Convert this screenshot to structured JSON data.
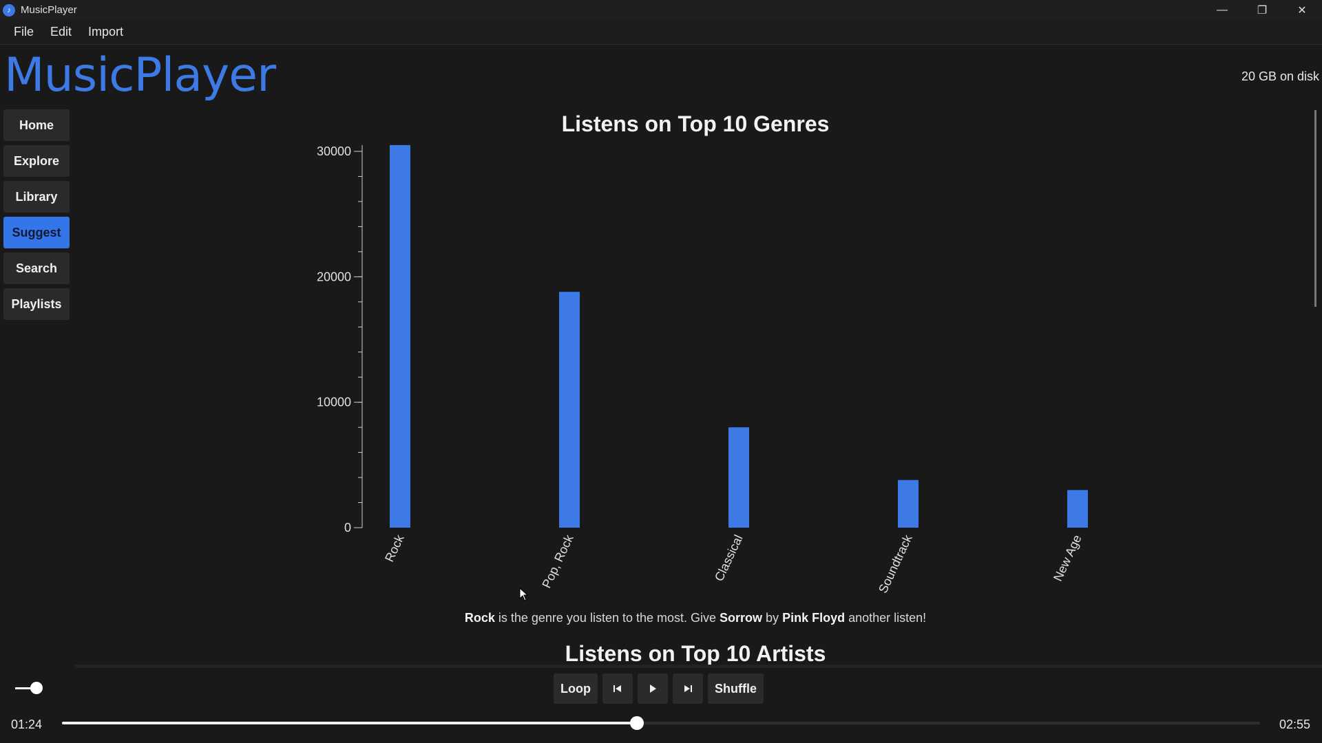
{
  "window": {
    "title": "MusicPlayer"
  },
  "menu": [
    "File",
    "Edit",
    "Import"
  ],
  "brand": "MusicPlayer",
  "disk_usage": "20 GB on disk",
  "nav": [
    {
      "label": "Home",
      "active": false
    },
    {
      "label": "Explore",
      "active": false
    },
    {
      "label": "Library",
      "active": false
    },
    {
      "label": "Suggest",
      "active": true
    },
    {
      "label": "Search",
      "active": false
    },
    {
      "label": "Playlists",
      "active": false
    }
  ],
  "chart_data": {
    "type": "bar",
    "title": "Listens on Top 10 Genres",
    "categories": [
      "Rock",
      "Pop, Rock",
      "Classical",
      "Soundtrack",
      "New Age"
    ],
    "values": [
      30500,
      18800,
      8000,
      3800,
      3000
    ],
    "yticks": [
      "0",
      "10000",
      "20000",
      "30000"
    ],
    "ylim": [
      0,
      30000
    ],
    "xlabel": "",
    "ylabel": "",
    "bar_color": "#3d7ae6"
  },
  "caption": {
    "genre": "Rock",
    "text1": " is the genre you listen to the most. Give ",
    "song": "Sorrow",
    "text2": " by ",
    "artist": "Pink Floyd",
    "text3": " another listen!"
  },
  "chart2_title": "Listens on Top 10 Artists",
  "player": {
    "loop_label": "Loop",
    "shuffle_label": "Shuffle",
    "elapsed": "01:24",
    "total": "02:55",
    "progress": 0.48,
    "volume": 0.75
  },
  "colors": {
    "accent": "#3d7ae6",
    "background": "#191919"
  }
}
